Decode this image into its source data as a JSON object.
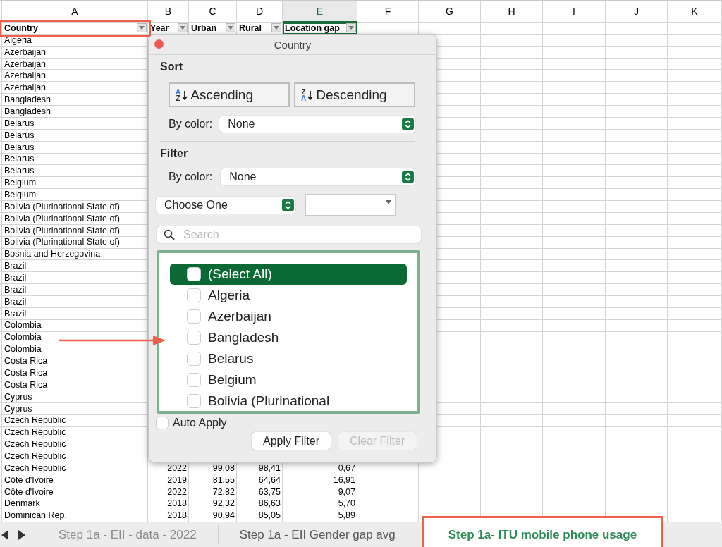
{
  "column_headers": [
    {
      "label": "A",
      "selected": false
    },
    {
      "label": "B",
      "selected": false
    },
    {
      "label": "C",
      "selected": false
    },
    {
      "label": "D",
      "selected": false
    },
    {
      "label": "E",
      "selected": true
    },
    {
      "label": "F",
      "selected": false
    },
    {
      "label": "G",
      "selected": false
    },
    {
      "label": "H",
      "selected": false
    },
    {
      "label": "I",
      "selected": false
    },
    {
      "label": "J",
      "selected": false
    },
    {
      "label": "K",
      "selected": false
    }
  ],
  "header_row": [
    {
      "text": "Country",
      "selected": false,
      "highlighted": true
    },
    {
      "text": "Year",
      "selected": false,
      "highlighted": false
    },
    {
      "text": "Urban",
      "selected": false,
      "highlighted": false
    },
    {
      "text": "Rural",
      "selected": false,
      "highlighted": false
    },
    {
      "text": "Location gap",
      "selected": true,
      "highlighted": false
    }
  ],
  "rows": [
    {
      "cells": [
        "Algeria"
      ]
    },
    {
      "cells": [
        "Azerbaijan"
      ]
    },
    {
      "cells": [
        "Azerbaijan"
      ]
    },
    {
      "cells": [
        "Azerbaijan"
      ]
    },
    {
      "cells": [
        "Azerbaijan"
      ]
    },
    {
      "cells": [
        "Bangladesh"
      ]
    },
    {
      "cells": [
        "Bangladesh"
      ]
    },
    {
      "cells": [
        "Belarus"
      ]
    },
    {
      "cells": [
        "Belarus"
      ]
    },
    {
      "cells": [
        "Belarus"
      ]
    },
    {
      "cells": [
        "Belarus"
      ]
    },
    {
      "cells": [
        "Belarus"
      ]
    },
    {
      "cells": [
        "Belgium"
      ]
    },
    {
      "cells": [
        "Belgium"
      ]
    },
    {
      "cells": [
        "Bolivia (Plurinational State of)"
      ]
    },
    {
      "cells": [
        "Bolivia (Plurinational State of)"
      ]
    },
    {
      "cells": [
        "Bolivia (Plurinational State of)"
      ]
    },
    {
      "cells": [
        "Bolivia (Plurinational State of)"
      ]
    },
    {
      "cells": [
        "Bosnia and Herzegovina"
      ]
    },
    {
      "cells": [
        "Brazil"
      ]
    },
    {
      "cells": [
        "Brazil"
      ]
    },
    {
      "cells": [
        "Brazil"
      ]
    },
    {
      "cells": [
        "Brazil"
      ]
    },
    {
      "cells": [
        "Brazil"
      ]
    },
    {
      "cells": [
        "Colombia"
      ]
    },
    {
      "cells": [
        "Colombia"
      ]
    },
    {
      "cells": [
        "Colombia"
      ]
    },
    {
      "cells": [
        "Costa Rica"
      ]
    },
    {
      "cells": [
        "Costa Rica"
      ]
    },
    {
      "cells": [
        "Costa Rica"
      ]
    },
    {
      "cells": [
        "Cyprus"
      ]
    },
    {
      "cells": [
        "Cyprus"
      ]
    },
    {
      "cells": [
        "Czech Republic"
      ]
    },
    {
      "cells": [
        "Czech Republic"
      ]
    },
    {
      "cells": [
        "Czech Republic"
      ]
    },
    {
      "cells": [
        "Czech Republic"
      ]
    },
    {
      "cells": [
        "Czech Republic",
        "2022",
        "99,08",
        "98,41",
        "0,67"
      ]
    },
    {
      "cells": [
        "Côte d'Ivoire",
        "2019",
        "81,55",
        "64,64",
        "16,91"
      ]
    },
    {
      "cells": [
        "Côte d'Ivoire",
        "2022",
        "72,82",
        "63,75",
        "9,07"
      ]
    },
    {
      "cells": [
        "Denmark",
        "2018",
        "92,32",
        "86,63",
        "5,70"
      ]
    },
    {
      "cells": [
        "Dominican Rep.",
        "2018",
        "90,94",
        "85,05",
        "5,89"
      ]
    }
  ],
  "filter_popup": {
    "title": "Country",
    "sort_heading": "Sort",
    "sort_buttons": [
      {
        "label": "Ascending",
        "icon_top": "A",
        "icon_bottom": "Z"
      },
      {
        "label": "Descending",
        "icon_top": "Z",
        "icon_bottom": "A"
      }
    ],
    "sort_by_color": {
      "label": "By color:",
      "value": "None"
    },
    "filter_heading": "Filter",
    "filter_by_color": {
      "label": "By color:",
      "value": "None"
    },
    "condition": {
      "value": "Choose One"
    },
    "search": {
      "placeholder": "Search"
    },
    "items": [
      {
        "label": "(Select All)",
        "checked": false,
        "selected": true
      },
      {
        "label": "Algeria",
        "checked": false,
        "selected": false
      },
      {
        "label": "Azerbaijan",
        "checked": false,
        "selected": false
      },
      {
        "label": "Bangladesh",
        "checked": false,
        "selected": false
      },
      {
        "label": "Belarus",
        "checked": false,
        "selected": false
      },
      {
        "label": "Belgium",
        "checked": false,
        "selected": false
      },
      {
        "label": "Bolivia (Plurinational",
        "checked": false,
        "selected": false
      }
    ],
    "auto_apply": {
      "label": "Auto Apply",
      "checked": false
    },
    "buttons": [
      {
        "label": "Apply Filter",
        "disabled": false
      },
      {
        "label": "Clear Filter",
        "disabled": true
      }
    ]
  },
  "sheet_tabs": [
    {
      "label": "Step 1a - EII - data - 2022",
      "selected": false,
      "highlighted": false
    },
    {
      "label": "Step 1a - EII Gender gap avg",
      "selected": false,
      "highlighted": false
    },
    {
      "label": "Step 1a- ITU mobile phone usage",
      "selected": true,
      "highlighted": true
    }
  ]
}
